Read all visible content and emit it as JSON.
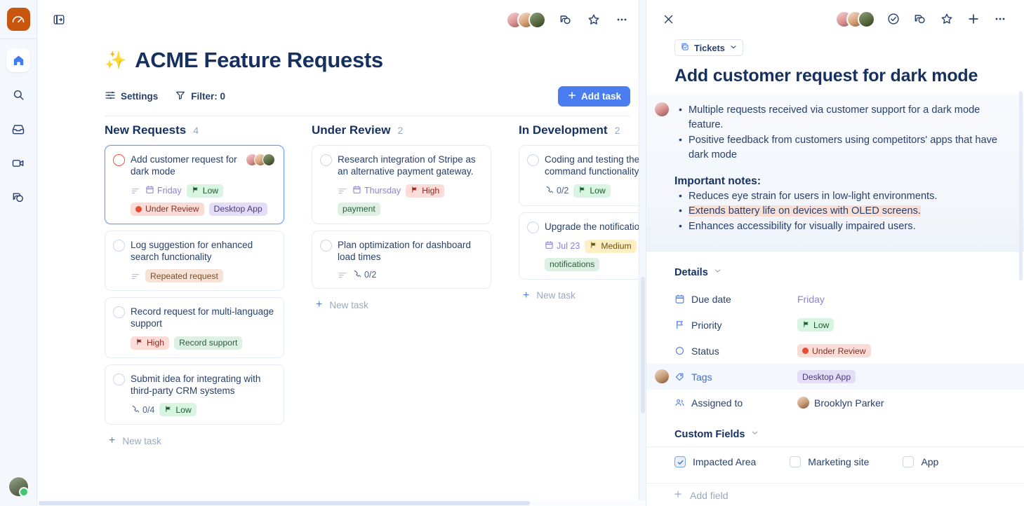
{
  "rail": {
    "logo_icon": "speedometer-logo-icon",
    "items": [
      {
        "icon": "home-icon",
        "name": "home",
        "active": true
      },
      {
        "icon": "search-icon",
        "name": "search",
        "active": false
      },
      {
        "icon": "inbox-icon",
        "name": "inbox",
        "active": false
      },
      {
        "icon": "video-icon",
        "name": "video",
        "active": false
      },
      {
        "icon": "chat-icon",
        "name": "chat",
        "active": false
      }
    ],
    "user_avatar": "user-avatar",
    "status": "online"
  },
  "board": {
    "toggle_icon": "panel-toggle-icon",
    "topbar_icons": [
      "comment-icon",
      "star-icon",
      "more-icon"
    ],
    "sparkle": "✨",
    "title": "ACME Feature Requests",
    "tools": {
      "settings_label": "Settings",
      "filter_label": "Filter: 0",
      "add_task_label": "Add task"
    },
    "new_task_label": "New task",
    "columns": [
      {
        "name": "New Requests",
        "count": "4",
        "cards": [
          {
            "title": "Add customer request for dark mode",
            "selected": true,
            "check_color": "red",
            "avatars": 3,
            "has_desc_icon": true,
            "date": "Friday",
            "priority": {
              "label": "Low",
              "kind": "low"
            },
            "status": {
              "label": "Under Review",
              "kind": "status"
            },
            "tags": [
              {
                "label": "Desktop App",
                "kind": "tag-purple"
              }
            ]
          },
          {
            "title": "Log suggestion for enhanced search functionality",
            "selected": false,
            "has_desc_icon": true,
            "tags": [
              {
                "label": "Repeated request",
                "kind": "tag-peach"
              }
            ]
          },
          {
            "title": "Record request for multi-language support",
            "selected": false,
            "priority": {
              "label": "High",
              "kind": "high"
            },
            "tags": [
              {
                "label": "Record support",
                "kind": "tag-green"
              }
            ]
          },
          {
            "title": "Submit idea for integrating with third-party CRM systems",
            "selected": false,
            "subtasks": "0/4",
            "priority": {
              "label": "Low",
              "kind": "low"
            }
          }
        ]
      },
      {
        "name": "Under Review",
        "count": "2",
        "cards": [
          {
            "title": "Research integration of Stripe as an alternative payment gateway.",
            "selected": false,
            "has_desc_icon": true,
            "date": "Thursday",
            "priority": {
              "label": "High",
              "kind": "high"
            },
            "tags": [
              {
                "label": "payment",
                "kind": "tag-green"
              }
            ]
          },
          {
            "title": "Plan optimization for dashboard load times",
            "selected": false,
            "has_desc_icon": true,
            "subtasks": "0/2"
          }
        ]
      },
      {
        "name": "In Development",
        "count": "2",
        "cards": [
          {
            "title": "Coding and testing the voice command functionality",
            "selected": false,
            "subtasks": "0/2",
            "priority": {
              "label": "Low",
              "kind": "low"
            }
          },
          {
            "title": "Upgrade the notification system",
            "selected": false,
            "date": "Jul 23",
            "priority": {
              "label": "Medium",
              "kind": "medium"
            },
            "tags": [
              {
                "label": "notifications",
                "kind": "tag-green"
              }
            ]
          }
        ]
      }
    ]
  },
  "detail": {
    "close_icon": "close-icon",
    "header_icons": [
      "check-circle-icon",
      "comment-icon",
      "star-icon",
      "plus-icon",
      "more-icon"
    ],
    "breadcrumb": "Tickets",
    "title": "Add customer request for dark mode",
    "description": {
      "bullets": [
        "Multiple requests received via customer support for a dark mode feature.",
        "Positive feedback from customers using competitors' apps that have dark mode"
      ],
      "notes_heading": "Important notes:",
      "notes": [
        {
          "text": "Reduces eye strain for users in low-light environments.",
          "highlight": false
        },
        {
          "text": "Extends battery life on devices with OLED screens.",
          "highlight": true
        },
        {
          "text": "Enhances accessibility for visually impaired users.",
          "highlight": false
        }
      ]
    },
    "details_heading": "Details",
    "details_rows": [
      {
        "icon": "calendar-icon",
        "label": "Due date",
        "value": "Friday",
        "value_kind": "date",
        "highlight": false
      },
      {
        "icon": "flag-icon",
        "label": "Priority",
        "value": "Low",
        "value_kind": "low",
        "highlight": false
      },
      {
        "icon": "circle-icon",
        "label": "Status",
        "value": "Under Review",
        "value_kind": "status",
        "highlight": false
      },
      {
        "icon": "tag-icon",
        "label": "Tags",
        "value": "Desktop App",
        "value_kind": "tag-purple",
        "highlight": true
      },
      {
        "icon": "people-icon",
        "label": "Assigned to",
        "value": "Brooklyn Parker",
        "value_kind": "person",
        "highlight": false
      }
    ],
    "custom_fields_heading": "Custom Fields",
    "custom_fields": [
      {
        "label": "Impacted Area",
        "checked": true
      },
      {
        "label": "Marketing site",
        "checked": false
      },
      {
        "label": "App",
        "checked": false
      }
    ],
    "add_field_label": "Add field"
  },
  "colors": {
    "accent": "#4a7ef0",
    "title": "#16315f",
    "logo": "#c8560f",
    "highlight": "#fadfd7"
  }
}
